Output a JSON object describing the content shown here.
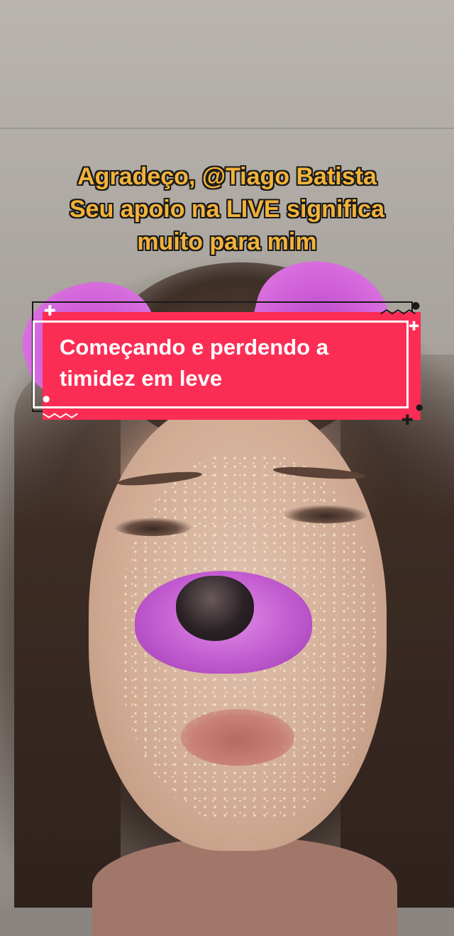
{
  "video": {
    "caption_lines": [
      "Agradeço, @Tiago Batista",
      "Seu apoio na LIVE significa",
      "muito para mim"
    ],
    "title_card": {
      "lines": [
        "Começando e perdendo a",
        "timidez em leve"
      ],
      "background_color": "#fc2d55",
      "text_color": "#ffffff"
    },
    "caption_color": "#f2b23a",
    "filter": "pink-dog-ears-nose"
  }
}
